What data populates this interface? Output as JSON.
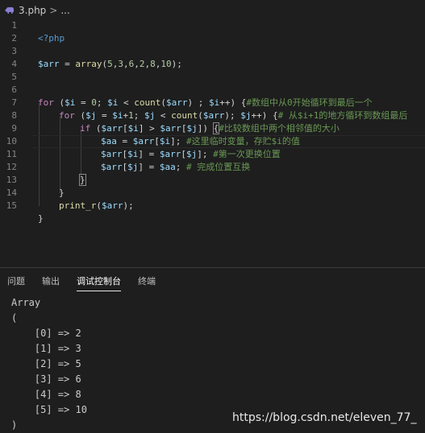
{
  "breadcrumb": {
    "file": "3.php",
    "chevron": ">",
    "ellipsis": "..."
  },
  "editor": {
    "line_numbers": [
      "1",
      "2",
      "3",
      "4",
      "5",
      "6",
      "7",
      "8",
      "9",
      "10",
      "11",
      "12",
      "13",
      "14",
      "15"
    ]
  },
  "code": {
    "l1": {
      "tag": "<?php"
    },
    "l3": {
      "var": "$arr",
      "eq": " = ",
      "fn": "array",
      "open": "(",
      "n1": "5",
      "c1": ",",
      "n2": "3",
      "c2": ",",
      "n3": "6",
      "c3": ",",
      "n4": "2",
      "c4": ",",
      "n5": "8",
      "c5": ",",
      "n6": "10",
      "close": ");"
    },
    "l6": {
      "kw": "for",
      "p1": " (",
      "v1": "$i",
      "p2": " = ",
      "n1": "0",
      "p3": "; ",
      "v2": "$i",
      "p4": " < ",
      "fn": "count",
      "p5": "(",
      "v3": "$arr",
      "p6": ") ; ",
      "v4": "$i",
      "p7": "++) {",
      "comment": "#数组中从0开始循环到最后一个"
    },
    "l7": {
      "kw": "for",
      "p1": " (",
      "v1": "$j",
      "p2": " = ",
      "v2": "$i",
      "p3": "+",
      "n1": "1",
      "p4": "; ",
      "v3": "$j",
      "p5": " < ",
      "fn": "count",
      "p6": "(",
      "v4": "$arr",
      "p7": "); ",
      "v5": "$j",
      "p8": "++) {",
      "comment": "# 从$i+1的地方循环到数组最后"
    },
    "l8": {
      "kw": "if",
      "p1": " (",
      "v1": "$arr",
      "p2": "[",
      "v2": "$i",
      "p3": "] > ",
      "v3": "$arr",
      "p4": "[",
      "v4": "$j",
      "p5": "]) ",
      "brace": "{",
      "comment": "#比较数组中两个相邻值的大小"
    },
    "l9": {
      "v1": "$aa",
      "p1": " = ",
      "v2": "$arr",
      "p2": "[",
      "v3": "$i",
      "p3": "]; ",
      "comment": "#这里临时变量，存贮$i的值"
    },
    "l10": {
      "v1": "$arr",
      "p1": "[",
      "v2": "$i",
      "p2": "] = ",
      "v3": "$arr",
      "p3": "[",
      "v4": "$j",
      "p4": "]; ",
      "comment": "#第一次更换位置"
    },
    "l11": {
      "v1": "$arr",
      "p1": "[",
      "v2": "$j",
      "p2": "] = ",
      "v3": "$aa",
      "p3": "; ",
      "comment": "# 完成位置互换"
    },
    "l12": {
      "brace": "}"
    },
    "l13": {
      "brace": "}"
    },
    "l14": {
      "fn": "print_r",
      "p1": "(",
      "v1": "$arr",
      "p2": ");"
    },
    "l15": {
      "brace": "}"
    }
  },
  "panel": {
    "tabs": [
      "问题",
      "输出",
      "调试控制台",
      "终端"
    ],
    "active_tab": "调试控制台"
  },
  "console": {
    "lines": [
      "Array",
      "(",
      "    [0] => 2",
      "    [1] => 3",
      "    [2] => 5",
      "    [3] => 6",
      "    [4] => 8",
      "    [5] => 10",
      ")"
    ]
  },
  "watermark": "https://blog.csdn.net/eleven_77_",
  "colors": {
    "background": "#1e1e1e",
    "keyword": "#c586c0",
    "variable": "#9cdcfe",
    "number": "#b5cea8",
    "function": "#dcdcaa",
    "comment": "#6a9955",
    "tag": "#569cd6"
  }
}
